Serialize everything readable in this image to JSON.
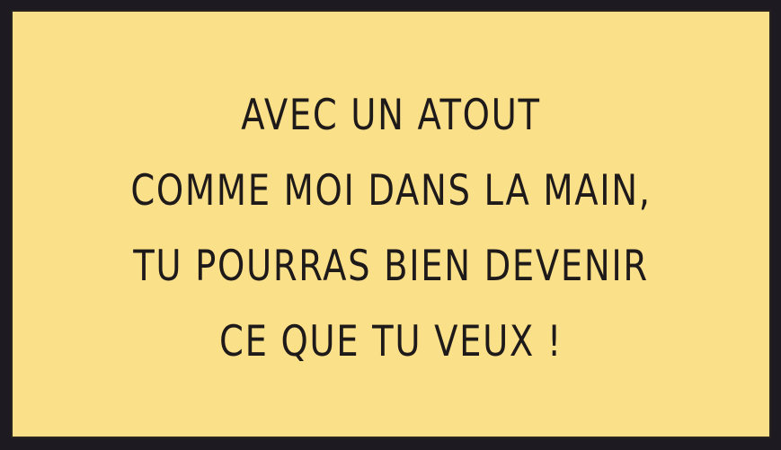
{
  "caption": {
    "lines": [
      "AVEC UN ATOUT",
      "COMME MOI DANS LA MAIN,",
      "TU POURRAS BIEN DEVENIR",
      "CE QUE TU VEUX !"
    ]
  },
  "colors": {
    "caption_background": "#fbe08a",
    "caption_text": "#1f1a1a",
    "panel_border": "#1e1a22"
  }
}
